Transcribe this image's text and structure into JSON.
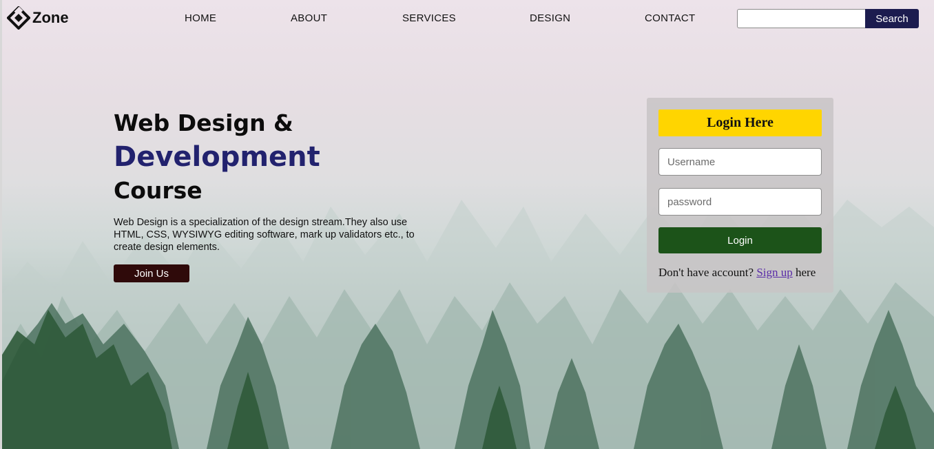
{
  "brand": {
    "name": "Zone",
    "icon": "diamond-logo-icon"
  },
  "nav": {
    "items": [
      {
        "label": "HOME"
      },
      {
        "label": "ABOUT"
      },
      {
        "label": "SERVICES"
      },
      {
        "label": "DESIGN"
      },
      {
        "label": "CONTACT"
      }
    ]
  },
  "search": {
    "placeholder": "",
    "value": "",
    "button_label": "Search"
  },
  "hero": {
    "line1": "Web Design &",
    "line2": "Development",
    "line3": "Course",
    "description": "Web Design is a specialization of the design stream.They also use HTML, CSS, WYSIWYG editing software, mark up validators etc., to create design elements.",
    "join_label": "Join Us"
  },
  "login": {
    "title": "Login Here",
    "username_placeholder": "Username",
    "password_placeholder": "password",
    "button_label": "Login",
    "signup_prefix": "Don't have account?",
    "signup_link": "Sign up",
    "signup_suffix": "here"
  },
  "colors": {
    "accent_navy": "#22226e",
    "search_button": "#1c1c4f",
    "login_header": "#ffd500",
    "login_button": "#1c5319",
    "join_button": "#2f0a0a"
  }
}
